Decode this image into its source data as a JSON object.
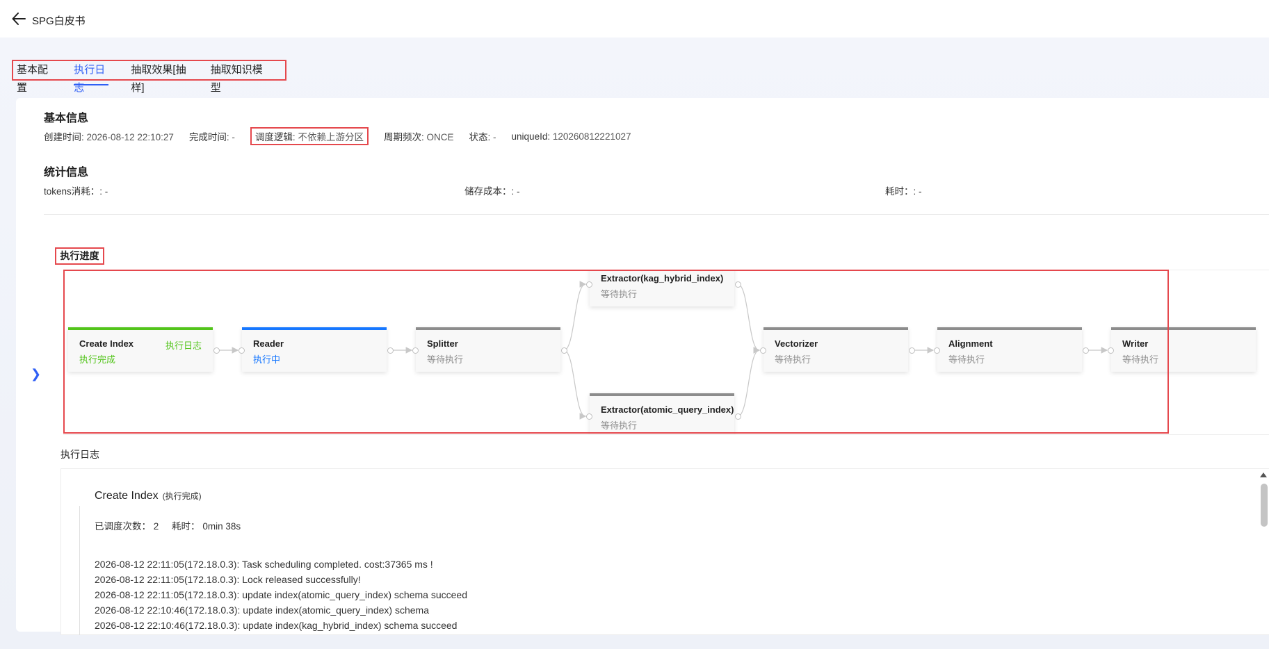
{
  "header": {
    "title": "SPG白皮书"
  },
  "tabs": [
    {
      "label": "基本配置",
      "active": false
    },
    {
      "label": "执行日志",
      "active": true
    },
    {
      "label": "抽取效果[抽样]",
      "active": false
    },
    {
      "label": "抽取知识模型",
      "active": false
    }
  ],
  "basic_info": {
    "title": "基本信息",
    "created_label": "创建时间:",
    "created_value": "2026-08-12 22:10:27",
    "finished_label": "完成时间:",
    "finished_value": "-",
    "schedule_label": "调度逻辑:",
    "schedule_value": "不依赖上游分区",
    "period_label": "周期频次:",
    "period_value": "ONCE",
    "status_label": "状态:",
    "status_value": "-",
    "uid_label": "uniqueId:",
    "uid_value": "120260812221027"
  },
  "stats": {
    "title": "统计信息",
    "tokens_label": "tokens消耗：",
    "tokens_value": ": -",
    "storage_label": "储存成本：",
    "storage_value": ": -",
    "time_label": "耗时：",
    "time_value": ": -"
  },
  "progress": {
    "title": "执行进度",
    "nodes": [
      {
        "name": "Create Index",
        "status": "执行完成",
        "state": "done",
        "link": "执行日志"
      },
      {
        "name": "Reader",
        "status": "执行中",
        "state": "running"
      },
      {
        "name": "Splitter",
        "status": "等待执行",
        "state": "waiting"
      },
      {
        "name": "Extractor(kag_hybrid_index)",
        "status": "等待执行",
        "state": "waiting"
      },
      {
        "name": "Extractor(atomic_query_index)",
        "status": "等待执行",
        "state": "waiting"
      },
      {
        "name": "Vectorizer",
        "status": "等待执行",
        "state": "waiting"
      },
      {
        "name": "Alignment",
        "status": "等待执行",
        "state": "waiting"
      },
      {
        "name": "Writer",
        "status": "等待执行",
        "state": "waiting"
      }
    ]
  },
  "log": {
    "title": "执行日志",
    "step_name": "Create Index",
    "step_status": "(执行完成)",
    "count_label": "已调度次数：",
    "count_value": "2",
    "time_label": "耗时：",
    "time_value": "0min 38s",
    "lines": [
      "2026-08-12 22:11:05(172.18.0.3): Task scheduling completed. cost:37365 ms !",
      "2026-08-12 22:11:05(172.18.0.3): Lock released successfully!",
      "2026-08-12 22:11:05(172.18.0.3): update index(atomic_query_index) schema succeed",
      "2026-08-12 22:10:46(172.18.0.3): update index(atomic_query_index) schema",
      "2026-08-12 22:10:46(172.18.0.3): update index(kag_hybrid_index) schema succeed"
    ]
  },
  "colors": {
    "accent": "#2f5ff5",
    "done": "#52c41a",
    "running": "#1677ff",
    "waiting": "#8c8c8c",
    "highlight": "#e5484d"
  },
  "icons": {
    "back": "arrow-left-icon",
    "expand": "chevron-right-icon"
  }
}
